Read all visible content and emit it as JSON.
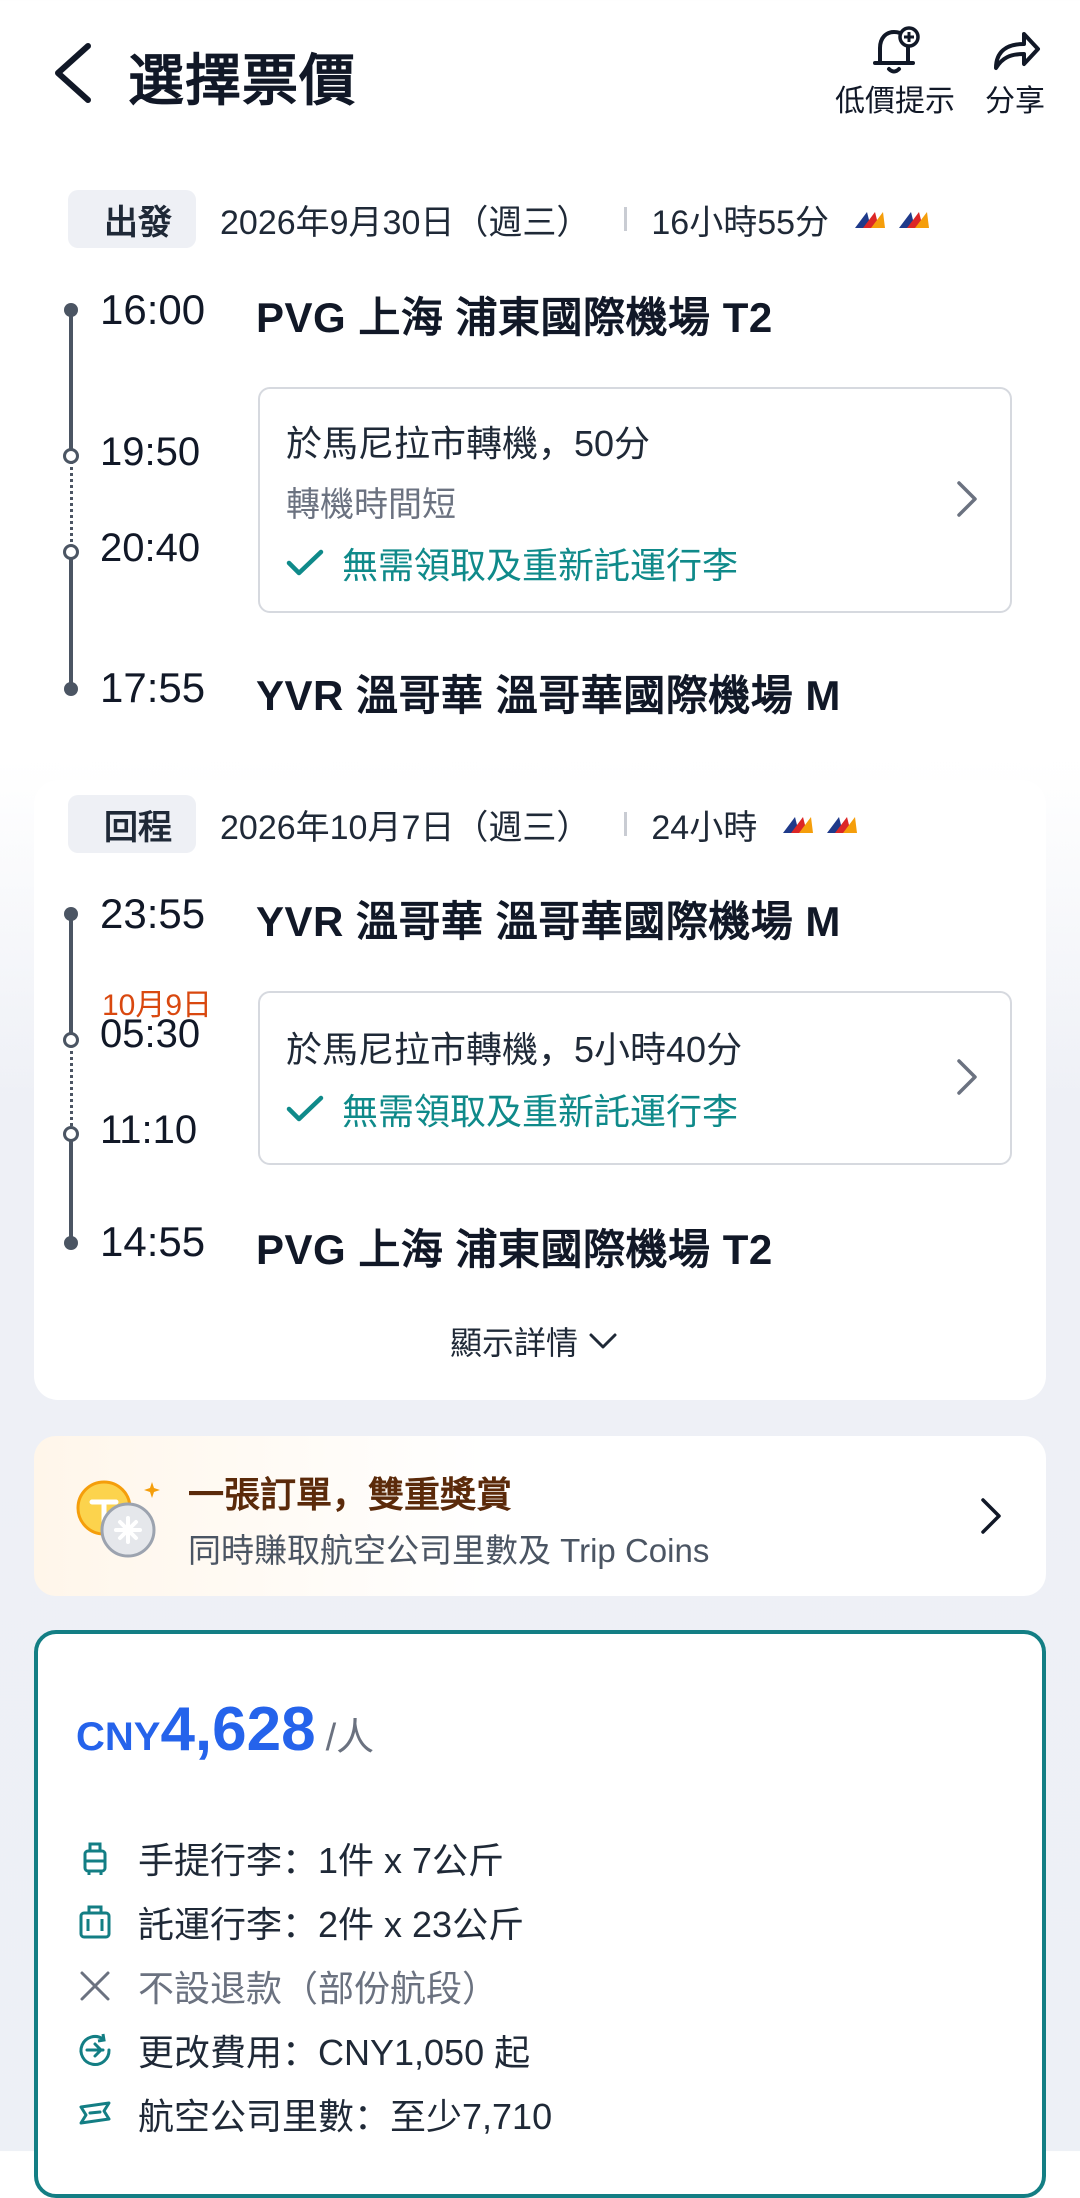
{
  "header": {
    "title": "選擇票價",
    "price_alert_label": "低價提示",
    "share_label": "分享"
  },
  "outbound": {
    "tag": "出發",
    "date": "2026年9月30日（週三）",
    "duration": "16小時55分",
    "depart_time": "16:00",
    "depart_airport": "PVG 上海 浦東國際機場 T2",
    "stop_arrive_time": "19:50",
    "stop_depart_time": "20:40",
    "transfer_text": "於馬尼拉市轉機，50分",
    "transfer_note": "轉機時間短",
    "baggage_note": "無需領取及重新託運行李",
    "arrive_time": "17:55",
    "arrive_airport": "YVR 溫哥華 溫哥華國際機場 M"
  },
  "return": {
    "tag": "回程",
    "date": "2026年10月7日（週三）",
    "duration": "24小時",
    "depart_time": "23:55",
    "depart_airport": "YVR 溫哥華 溫哥華國際機場 M",
    "stop_date": "10月9日",
    "stop_arrive_time": "05:30",
    "stop_depart_time": "11:10",
    "transfer_text": "於馬尼拉市轉機，5小時40分",
    "baggage_note": "無需領取及重新託運行李",
    "arrive_time": "14:55",
    "arrive_airport": "PVG 上海 浦東國際機場 T2"
  },
  "show_details_label": "顯示詳情",
  "promo": {
    "title": "一張訂單，雙重獎賞",
    "subtitle": "同時賺取航空公司里數及 Trip Coins"
  },
  "fare": {
    "currency": "CNY",
    "amount": "4,628",
    "per": "/人",
    "features": [
      {
        "icon": "carry-on-bag-icon",
        "text": "手提行李：1件 x 7公斤"
      },
      {
        "icon": "checked-bag-icon",
        "text": "託運行李：2件 x 23公斤"
      },
      {
        "icon": "x-icon",
        "text": "不設退款（部份航段）"
      },
      {
        "icon": "plane-change-icon",
        "text": "更改費用：CNY1,050 起"
      },
      {
        "icon": "miles-icon",
        "text": "航空公司里數：至少7,710"
      }
    ]
  },
  "colors": {
    "accent_teal": "#0f8a8a",
    "price_blue": "#2563eb",
    "card_border": "#137e84",
    "stop_date_orange": "#d9480f"
  }
}
